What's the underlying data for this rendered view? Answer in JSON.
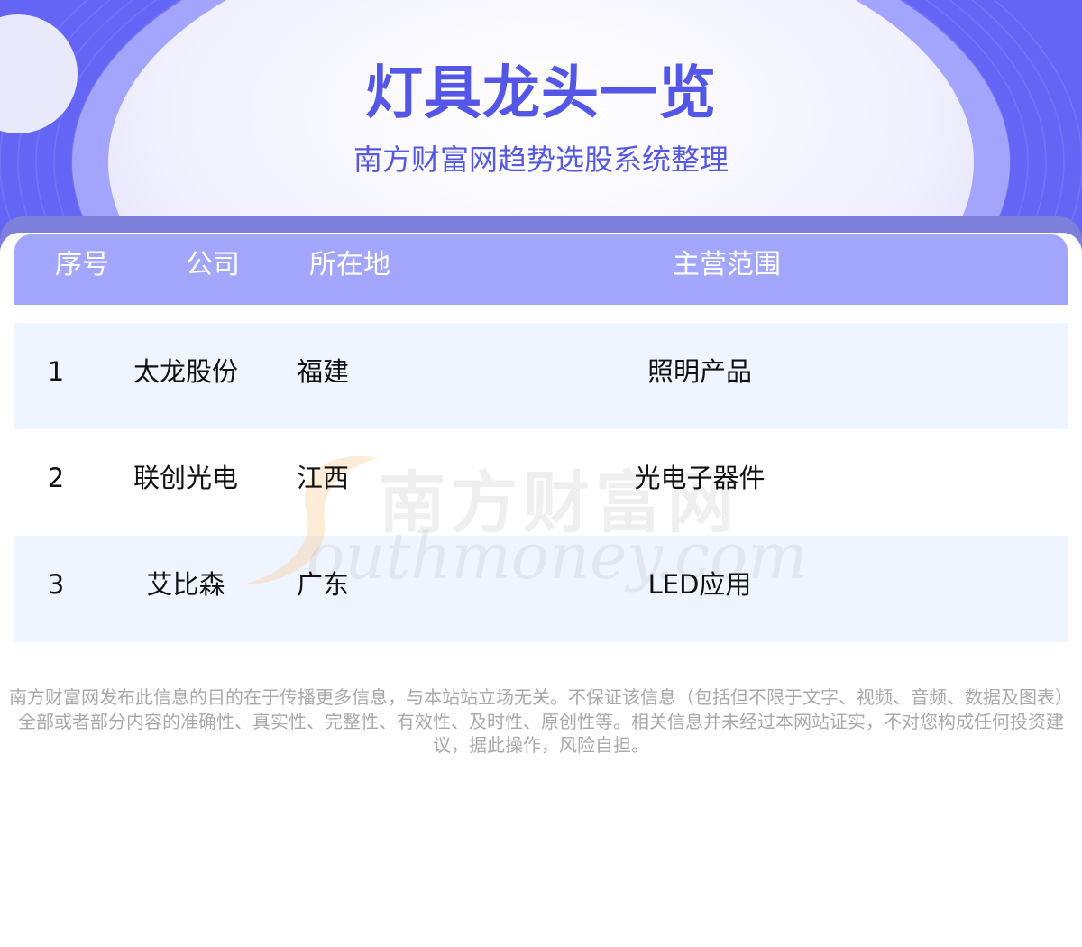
{
  "header": {
    "title": "灯具龙头一览",
    "subtitle": "南方财富网趋势选股系统整理"
  },
  "table": {
    "columns": [
      "序号",
      "公司",
      "所在地",
      "主营范围"
    ],
    "rows": [
      {
        "index": "1",
        "company": "太龙股份",
        "location": "福建",
        "business": "照明产品"
      },
      {
        "index": "2",
        "company": "联创光电",
        "location": "江西",
        "business": "光电子器件"
      },
      {
        "index": "3",
        "company": "艾比森",
        "location": "广东",
        "business": "LED应用"
      }
    ]
  },
  "watermark": {
    "cn": "南方财富网",
    "en": "outhmoney.com"
  },
  "disclaimer": "南方财富网发布此信息的目的在于传播更多信息，与本站站立场无关。不保证该信息（包括但不限于文字、视频、音频、数据及图表）全部或者部分内容的准确性、真实性、完整性、有效性、及时性、原创性等。相关信息并未经过本网站证实，不对您构成任何投资建议，据此操作，风险自担。",
  "colors": {
    "hero_bg": "#6b6cf7",
    "title": "#5456e6",
    "header_row": "#a3a6fd",
    "alt_row": "#ecf3ff",
    "disclaimer": "#a9a9a9"
  }
}
